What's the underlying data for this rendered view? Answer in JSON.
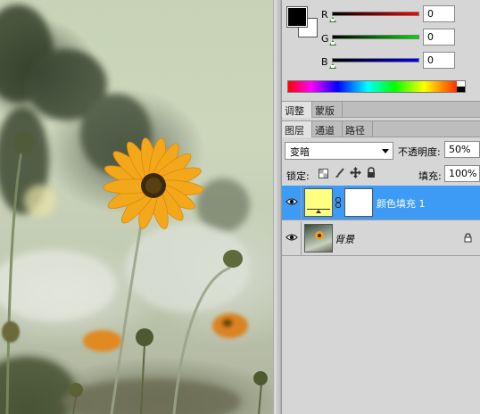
{
  "color_panel": {
    "channels": [
      {
        "label": "R",
        "value": "0",
        "gradient_end": "#ff0000"
      },
      {
        "label": "G",
        "value": "0",
        "gradient_end": "#00e000"
      },
      {
        "label": "B",
        "value": "0",
        "gradient_end": "#0000ff"
      }
    ],
    "foreground": "#000000",
    "background": "#ffffff"
  },
  "adjust_tabs": [
    {
      "label": "调整",
      "active": true
    },
    {
      "label": "蒙版",
      "active": false
    }
  ],
  "layer_tabs": [
    {
      "label": "图层",
      "active": true
    },
    {
      "label": "通道",
      "active": false
    },
    {
      "label": "路径",
      "active": false
    }
  ],
  "layers_panel": {
    "blend_mode": "变暗",
    "opacity_label": "不透明度:",
    "opacity_value": "50%",
    "lock_label": "锁定:",
    "fill_label": "填充:",
    "fill_value": "100%"
  },
  "layers": [
    {
      "name": "颜色填充 1",
      "selected": true,
      "fill_color": "#ffff80"
    },
    {
      "name": "背景",
      "selected": false
    }
  ],
  "icons": [
    "eye-icon",
    "chain-icon",
    "lock-icon",
    "lock-transparent-icon",
    "lock-paint-icon",
    "move-icon"
  ],
  "colors": {
    "selection": "#3d9af5",
    "panel_bg": "#d6d6d6"
  }
}
